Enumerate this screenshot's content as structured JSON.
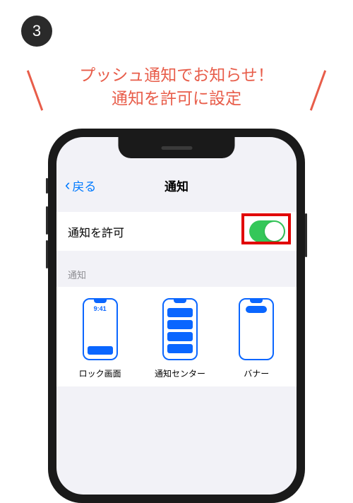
{
  "step_number": "3",
  "headline_line1": "プッシュ通知でお知らせ！",
  "headline_line2": "通知を許可に設定",
  "nav": {
    "back_label": "戻る",
    "title": "通知"
  },
  "allow_row": {
    "label": "通知を許可",
    "toggle_on": true
  },
  "section_label": "通知",
  "alert_styles": [
    {
      "label": "ロック画面",
      "time": "9:41"
    },
    {
      "label": "通知センター"
    },
    {
      "label": "バナー"
    }
  ],
  "colors": {
    "accent_red": "#e85d4a",
    "highlight_red": "#e10000",
    "ios_blue": "#007aff",
    "toggle_green": "#34c759",
    "outline_blue": "#0a66ff"
  }
}
